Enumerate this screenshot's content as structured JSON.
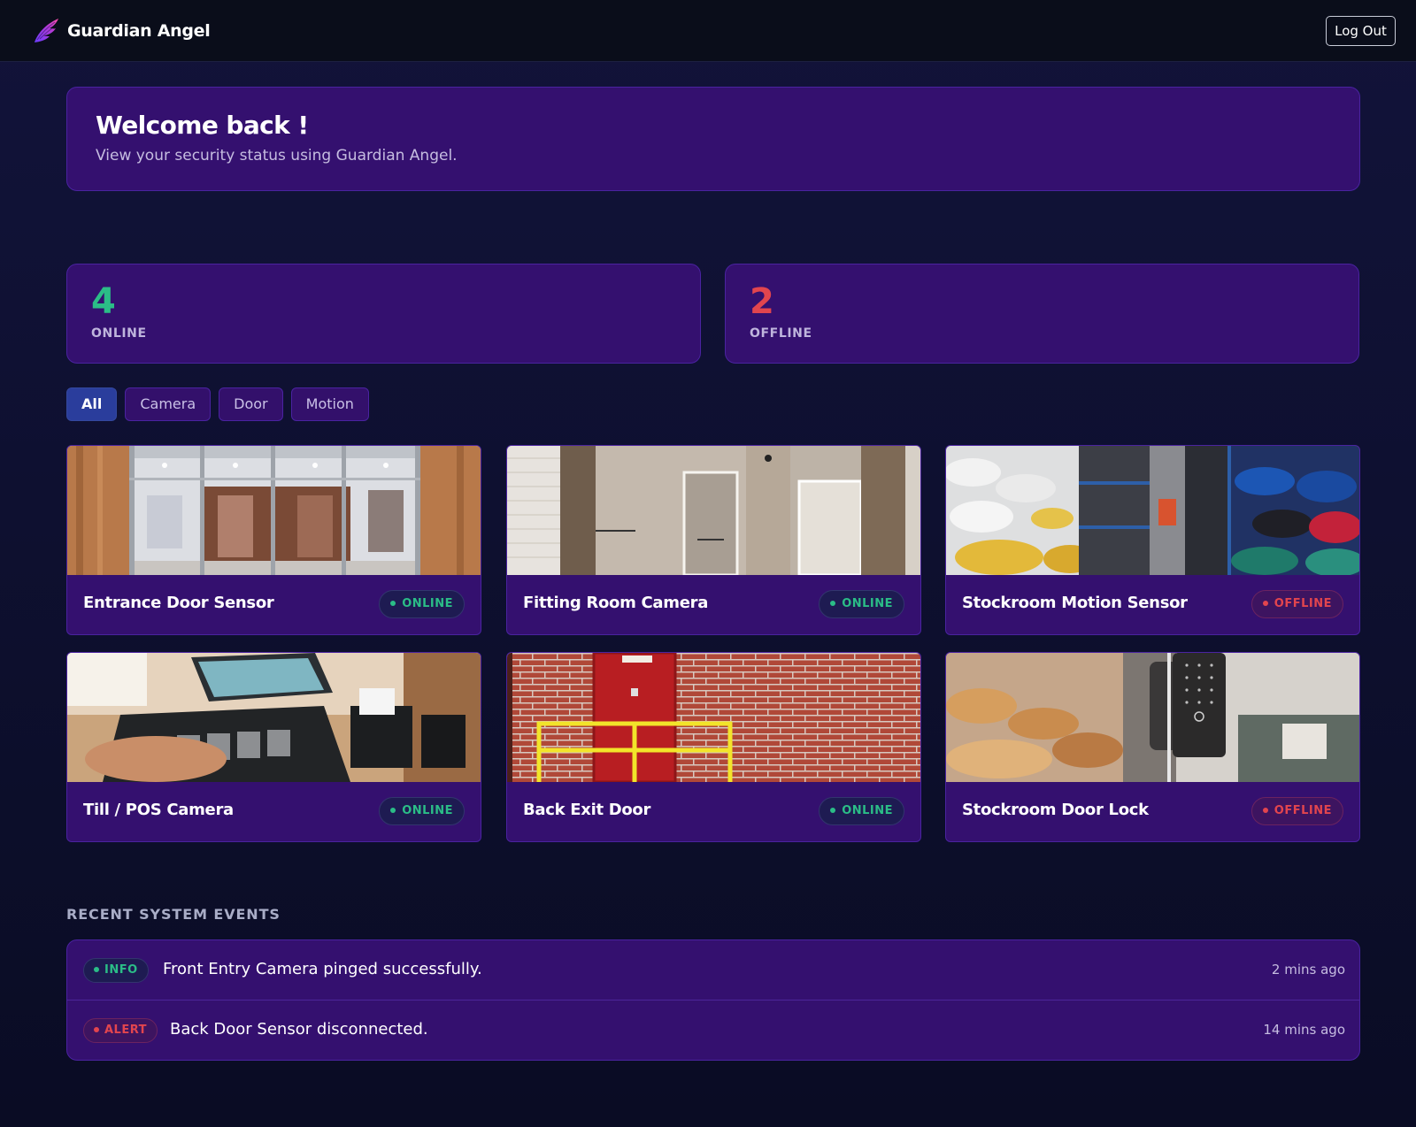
{
  "header": {
    "brand_name": "Guardian Angel",
    "logout_label": "Log Out"
  },
  "welcome": {
    "title": "Welcome back !",
    "subtitle": "View your security status using Guardian Angel."
  },
  "stats": {
    "online_count": "4",
    "online_label": "ONLINE",
    "offline_count": "2",
    "offline_label": "OFFLINE"
  },
  "filters": {
    "all": "All",
    "camera": "Camera",
    "door": "Door",
    "motion": "Motion",
    "active": "All"
  },
  "devices": [
    {
      "name": "Entrance Door Sensor",
      "status": "ONLINE",
      "image": "store-entrance-photo"
    },
    {
      "name": "Fitting Room Camera",
      "status": "ONLINE",
      "image": "fitting-room-photo"
    },
    {
      "name": "Stockroom Motion Sensor",
      "status": "OFFLINE",
      "image": "stockroom-shelves-photo"
    },
    {
      "name": "Till / POS Camera",
      "status": "ONLINE",
      "image": "pos-till-photo"
    },
    {
      "name": "Back Exit Door",
      "status": "ONLINE",
      "image": "fire-exit-door-photo"
    },
    {
      "name": "Stockroom Door Lock",
      "status": "OFFLINE",
      "image": "smart-door-lock-photo"
    }
  ],
  "events": {
    "title": "RECENT SYSTEM EVENTS",
    "items": [
      {
        "level": "INFO",
        "message": "Front Entry Camera pinged successfully.",
        "time": "2 mins ago"
      },
      {
        "level": "ALERT",
        "message": "Back Door Sensor disconnected.",
        "time": "14 mins ago"
      }
    ]
  },
  "colors": {
    "online": "#2bbd87",
    "offline": "#e2454e",
    "card": "#34106f",
    "active_filter": "#2a3d9c"
  },
  "icons": {
    "brand": "angel-wing-icon",
    "status_dot": "status-dot-icon"
  }
}
